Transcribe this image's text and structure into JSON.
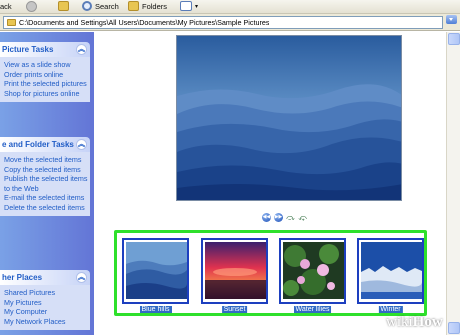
{
  "toolbar": {
    "back_label": "ack",
    "search_label": "Search",
    "folders_label": "Folders"
  },
  "address": {
    "path": "C:\\Documents and Settings\\All Users\\Documents\\My Pictures\\Sample Pictures"
  },
  "taskpane": {
    "picture_tasks": {
      "title": "Picture Tasks",
      "links": [
        "View as a slide show",
        "Order prints online",
        "Print the selected pictures",
        "Shop for pictures online"
      ]
    },
    "file_folder_tasks": {
      "title": "e and Folder Tasks",
      "links": [
        "Move the selected items",
        "Copy the selected items",
        "Publish the selected items to the Web",
        "E-mail the selected items",
        "Delete the selected items"
      ]
    },
    "other_places": {
      "title": "her Places",
      "links": [
        "Shared Pictures",
        "My Pictures",
        "My Computer",
        "My Network Places"
      ]
    }
  },
  "filmstrip": {
    "items": [
      {
        "label": "Blue hills"
      },
      {
        "label": "Sunset"
      },
      {
        "label": "Water lilies"
      },
      {
        "label": "Winter"
      }
    ],
    "highlight_color": "#2ee02b",
    "selection_color": "#316ac5"
  },
  "watermark": {
    "prefix": "wiki",
    "suffix": "How"
  }
}
